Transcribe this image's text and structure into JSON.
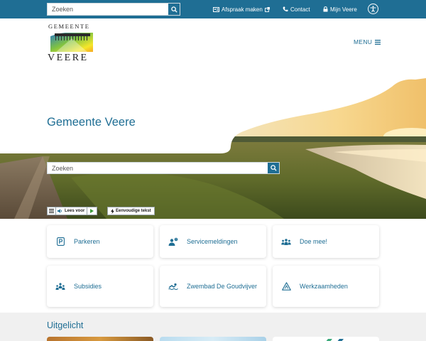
{
  "topbar": {
    "search_placeholder": "Zoeken",
    "links": {
      "appointment": "Afspraak maken",
      "contact": "Contact",
      "my_veere": "Mijn Veere"
    }
  },
  "logo": {
    "top_text": "GEMEENTE",
    "bottom_text": "VEERE"
  },
  "menu_label": "MENU",
  "hero": {
    "title": "Gemeente Veere",
    "search_placeholder": "Zoeken"
  },
  "readspeaker": {
    "read_label": "Lees voor"
  },
  "easy_text_label": "Eenvoudige tekst",
  "tiles": [
    {
      "label": "Parkeren",
      "icon": "parking-icon"
    },
    {
      "label": "Servicemeldingen",
      "icon": "report-icon"
    },
    {
      "label": "Doe mee!",
      "icon": "group-icon"
    },
    {
      "label": "Subsidies",
      "icon": "subsidy-icon"
    },
    {
      "label": "Zwembad De Goudvijver",
      "icon": "swimmer-icon"
    },
    {
      "label": "Werkzaamheden",
      "icon": "warning-icon"
    }
  ],
  "featured": {
    "title": "Uitgelicht"
  },
  "colors": {
    "primary": "#1f6e94",
    "featured_bg": "#f0f0f0"
  }
}
